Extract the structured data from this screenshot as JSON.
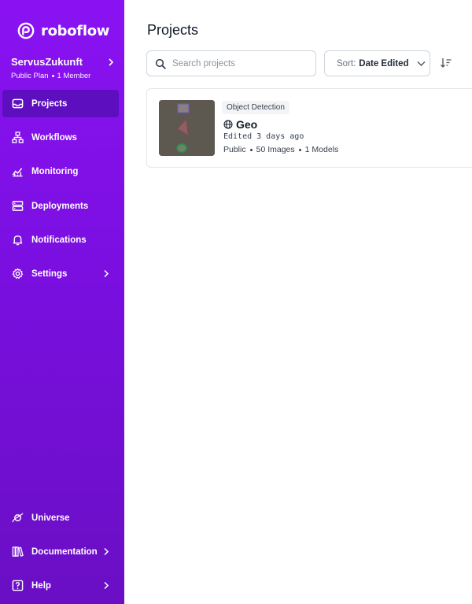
{
  "brand": {
    "name": "roboflow"
  },
  "workspace": {
    "name": "ServusZukunft",
    "plan": "Public Plan",
    "members": "1 Member"
  },
  "nav": {
    "items": [
      {
        "label": "Projects",
        "icon": "inbox-icon",
        "active": true
      },
      {
        "label": "Workflows",
        "icon": "workflow-icon"
      },
      {
        "label": "Monitoring",
        "icon": "chart-icon"
      },
      {
        "label": "Deployments",
        "icon": "server-icon"
      },
      {
        "label": "Notifications",
        "icon": "bell-icon"
      },
      {
        "label": "Settings",
        "icon": "gear-icon",
        "chevron": true
      }
    ],
    "bottom": [
      {
        "label": "Universe",
        "icon": "planet-icon"
      },
      {
        "label": "Documentation",
        "icon": "books-icon",
        "chevron": true
      },
      {
        "label": "Help",
        "icon": "help-icon",
        "chevron": true
      }
    ]
  },
  "main": {
    "title": "Projects",
    "search": {
      "placeholder": "Search projects",
      "value": ""
    },
    "sort": {
      "label": "Sort:",
      "value": "Date Edited"
    }
  },
  "projects": [
    {
      "type": "Object Detection",
      "name": "Geo",
      "edited": "Edited 3 days ago",
      "visibility": "Public",
      "images": "50 Images",
      "models": "1 Models"
    }
  ],
  "colors": {
    "sidebar_top": "#8a12f2",
    "sidebar_bottom": "#6a0fc4",
    "active_item": "#5d0fc0"
  }
}
